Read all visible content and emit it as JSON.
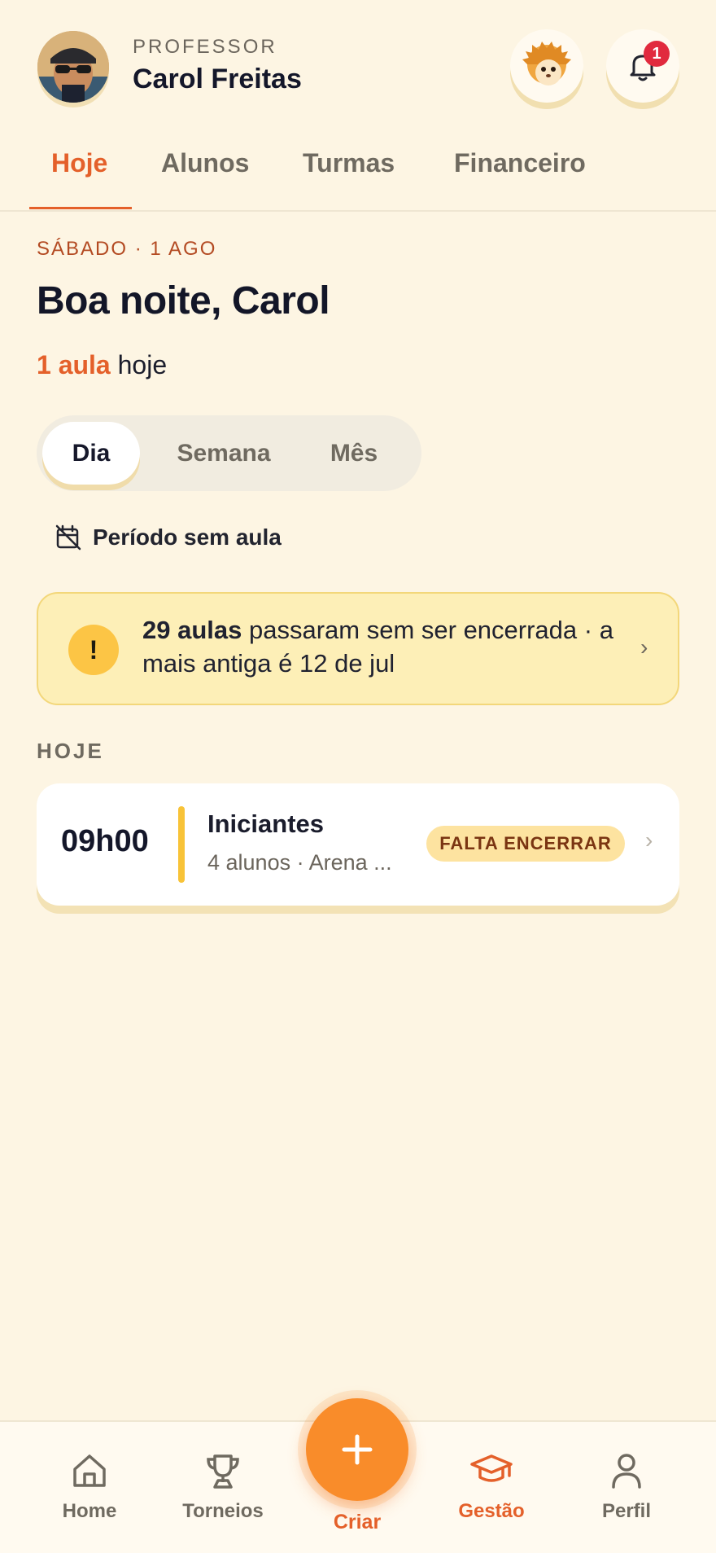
{
  "header": {
    "role": "PROFESSOR",
    "name": "Carol Freitas",
    "notification_count": "1"
  },
  "tabs": [
    {
      "label": "Hoje",
      "active": true
    },
    {
      "label": "Alunos",
      "active": false
    },
    {
      "label": "Turmas",
      "active": false
    },
    {
      "label": "Financeiro",
      "active": false
    }
  ],
  "today": {
    "date": "SÁBADO · 1 AGO",
    "greeting": "Boa noite, Carol",
    "count_highlight": "1 aula",
    "count_suffix": " hoje"
  },
  "segmented": [
    {
      "label": "Dia",
      "active": true
    },
    {
      "label": "Semana",
      "active": false
    },
    {
      "label": "Mês",
      "active": false
    }
  ],
  "period_text": "Período sem aula",
  "alert": {
    "icon": "!",
    "bold": "29 aulas",
    "text": " passaram sem ser encerrada · a mais antiga é 12 de jul",
    "chevron": "›"
  },
  "section_title": "HOJE",
  "lesson": {
    "time": "09h00",
    "title": "Iniciantes",
    "subtitle": "4 alunos · Arena ...",
    "status": "FALTA ENCERRAR",
    "chevron": "›"
  },
  "bottom_nav": [
    {
      "label": "Home",
      "icon": "home-icon"
    },
    {
      "label": "Torneios",
      "icon": "trophy-icon"
    },
    {
      "label": "Criar",
      "icon": "plus-icon"
    },
    {
      "label": "Gestão",
      "icon": "graduation-cap-icon",
      "active": true
    },
    {
      "label": "Perfil",
      "icon": "user-icon"
    }
  ],
  "colors": {
    "accent": "#e4602a",
    "background": "#fdf5e3",
    "alert_bg": "#fdefb7",
    "fab": "#f98c2a"
  }
}
